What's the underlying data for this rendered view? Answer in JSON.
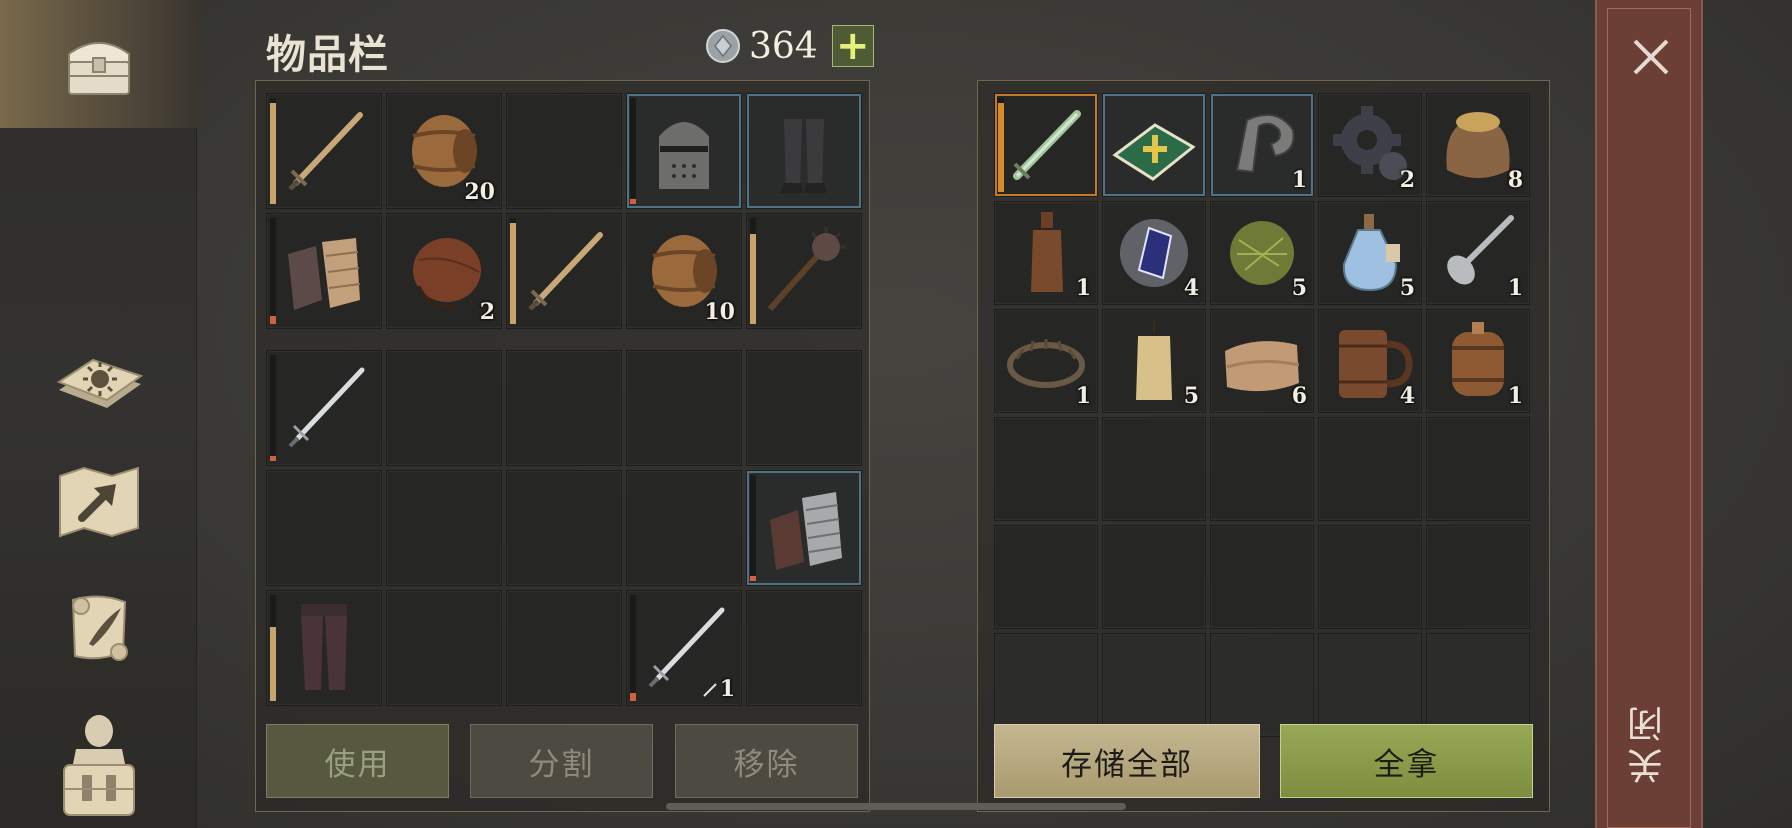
{
  "header": {
    "title": "物品栏",
    "currency_value": "364",
    "plus_label": "+"
  },
  "sidebar": {
    "tabs": [
      {
        "name": "chest-icon",
        "active": true
      },
      {
        "name": "sun-book-icon",
        "active": false
      },
      {
        "name": "map-arrow-icon",
        "active": false
      },
      {
        "name": "scroll-quill-icon",
        "active": false
      },
      {
        "name": "backpack-character-icon",
        "active": false
      }
    ]
  },
  "inventory": {
    "equipped": [
      {
        "icon": "longsword-icon",
        "qty": "",
        "frame": "",
        "bar": {
          "level": 0.95,
          "color": "#c8a46a"
        }
      },
      {
        "icon": "barrel-icon",
        "qty": "20",
        "frame": "",
        "bar": null
      },
      {
        "icon": "",
        "qty": "",
        "frame": "",
        "bar": null
      },
      {
        "icon": "great-helm-icon",
        "qty": "",
        "frame": "blue",
        "bar": {
          "level": 0.05,
          "color": "#d06040"
        }
      },
      {
        "icon": "chain-leggings-icon",
        "qty": "",
        "frame": "blue",
        "bar": null
      },
      {
        "icon": "gauntlets-icon",
        "qty": "",
        "frame": "",
        "bar": {
          "level": 0.08,
          "color": "#d06040"
        }
      },
      {
        "icon": "waterskin-icon",
        "qty": "2",
        "frame": "",
        "bar": null
      },
      {
        "icon": "longsword-icon",
        "qty": "",
        "frame": "",
        "bar": {
          "level": 0.95,
          "color": "#c8a46a"
        }
      },
      {
        "icon": "barrel-icon",
        "qty": "10",
        "frame": "",
        "bar": null
      },
      {
        "icon": "mace-icon",
        "qty": "",
        "frame": "",
        "bar": {
          "level": 0.85,
          "color": "#c8a46a"
        }
      }
    ],
    "backpack": [
      {
        "icon": "steel-sword-icon",
        "qty": "",
        "frame": "",
        "bar": {
          "level": 0.05,
          "color": "#d06040"
        }
      },
      {
        "icon": "",
        "qty": "",
        "frame": "",
        "bar": null
      },
      {
        "icon": "",
        "qty": "",
        "frame": "",
        "bar": null
      },
      {
        "icon": "",
        "qty": "",
        "frame": "",
        "bar": null
      },
      {
        "icon": "",
        "qty": "",
        "frame": "",
        "bar": null
      },
      {
        "icon": "",
        "qty": "",
        "frame": "",
        "bar": null
      },
      {
        "icon": "",
        "qty": "",
        "frame": "",
        "bar": null
      },
      {
        "icon": "",
        "qty": "",
        "frame": "",
        "bar": null
      },
      {
        "icon": "",
        "qty": "",
        "frame": "",
        "bar": null
      },
      {
        "icon": "plate-gauntlets-icon",
        "qty": "",
        "frame": "blue",
        "bar": {
          "level": 0.05,
          "color": "#d06040"
        }
      },
      {
        "icon": "leather-pants-icon",
        "qty": "",
        "frame": "",
        "bar": {
          "level": 0.7,
          "color": "#c8a46a"
        }
      },
      {
        "icon": "",
        "qty": "",
        "frame": "",
        "bar": null
      },
      {
        "icon": "",
        "qty": "",
        "frame": "",
        "bar": null
      },
      {
        "icon": "steel-sword-icon",
        "qty": "1",
        "qty_prefix_icon": "dagger-icon",
        "frame": "",
        "bar": {
          "level": 0.08,
          "color": "#d06040"
        }
      },
      {
        "icon": "",
        "qty": "",
        "frame": "",
        "bar": null
      }
    ],
    "buttons": {
      "use": "使用",
      "split": "分割",
      "remove": "移除"
    }
  },
  "storage": {
    "items": [
      {
        "icon": "green-dagger-icon",
        "qty": "",
        "frame": "orange",
        "bar": {
          "level": 0.95,
          "color": "#d98a2a"
        }
      },
      {
        "icon": "holy-book-icon",
        "qty": "",
        "frame": "blue",
        "bar": null
      },
      {
        "icon": "iron-hook-icon",
        "qty": "1",
        "frame": "blue",
        "bar": null
      },
      {
        "icon": "gear-icon",
        "qty": "2",
        "frame": "",
        "bar": null
      },
      {
        "icon": "grain-sack-icon",
        "qty": "8",
        "frame": "",
        "bar": null
      },
      {
        "icon": "bottle-icon",
        "qty": "1",
        "frame": "",
        "bar": null
      },
      {
        "icon": "crystal-icon",
        "qty": "4",
        "frame": "",
        "bar": null
      },
      {
        "icon": "herb-ball-icon",
        "qty": "5",
        "frame": "",
        "bar": null
      },
      {
        "icon": "potion-icon",
        "qty": "5",
        "frame": "",
        "bar": null
      },
      {
        "icon": "spoon-icon",
        "qty": "1",
        "frame": "",
        "bar": null
      },
      {
        "icon": "bear-trap-icon",
        "qty": "1",
        "frame": "",
        "bar": null
      },
      {
        "icon": "candle-icon",
        "qty": "5",
        "frame": "",
        "bar": null
      },
      {
        "icon": "cloth-icon",
        "qty": "6",
        "frame": "",
        "bar": null
      },
      {
        "icon": "tankard-icon",
        "qty": "4",
        "frame": "",
        "bar": null
      },
      {
        "icon": "small-keg-icon",
        "qty": "1",
        "frame": "",
        "bar": null
      }
    ],
    "empty_rows": 3,
    "buttons": {
      "store_all": "存储全部",
      "take_all": "全拿"
    }
  },
  "close": {
    "label": "关闭"
  },
  "colors": {
    "accent_gold": "#c8a46a",
    "close_bg": "#6b3e36",
    "take_green": "#8a9c49"
  }
}
